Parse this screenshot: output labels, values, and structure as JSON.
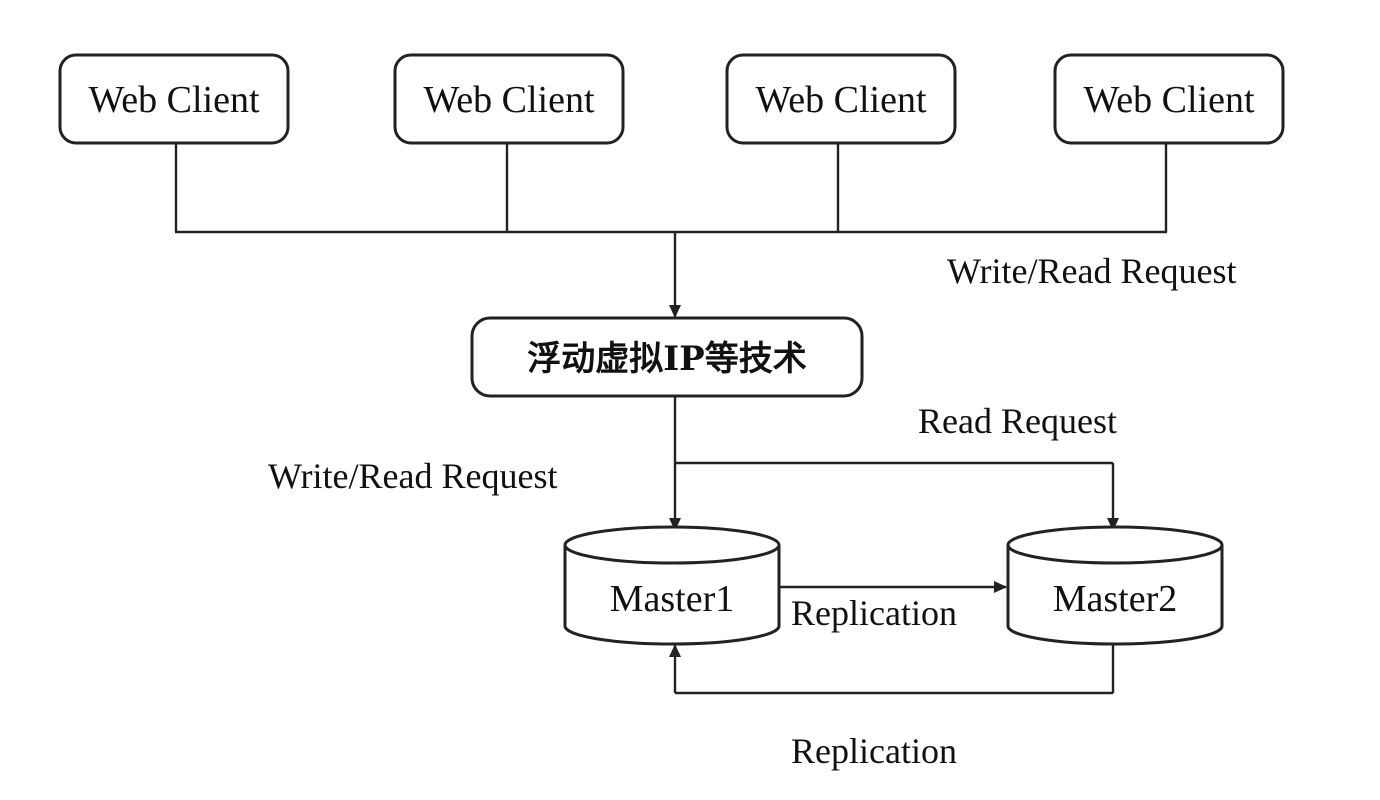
{
  "clients": [
    {
      "label": "Web Client"
    },
    {
      "label": "Web Client"
    },
    {
      "label": "Web Client"
    },
    {
      "label": "Web Client"
    }
  ],
  "vip_box": {
    "label": "浮动虚拟IP等技术"
  },
  "masters": [
    {
      "label": "Master1"
    },
    {
      "label": "Master2"
    }
  ],
  "labels": {
    "write_read_top": "Write/Read Request",
    "write_read_left": "Write/Read Request",
    "read_request": "Read Request",
    "replication_forward": "Replication",
    "replication_back": "Replication"
  }
}
